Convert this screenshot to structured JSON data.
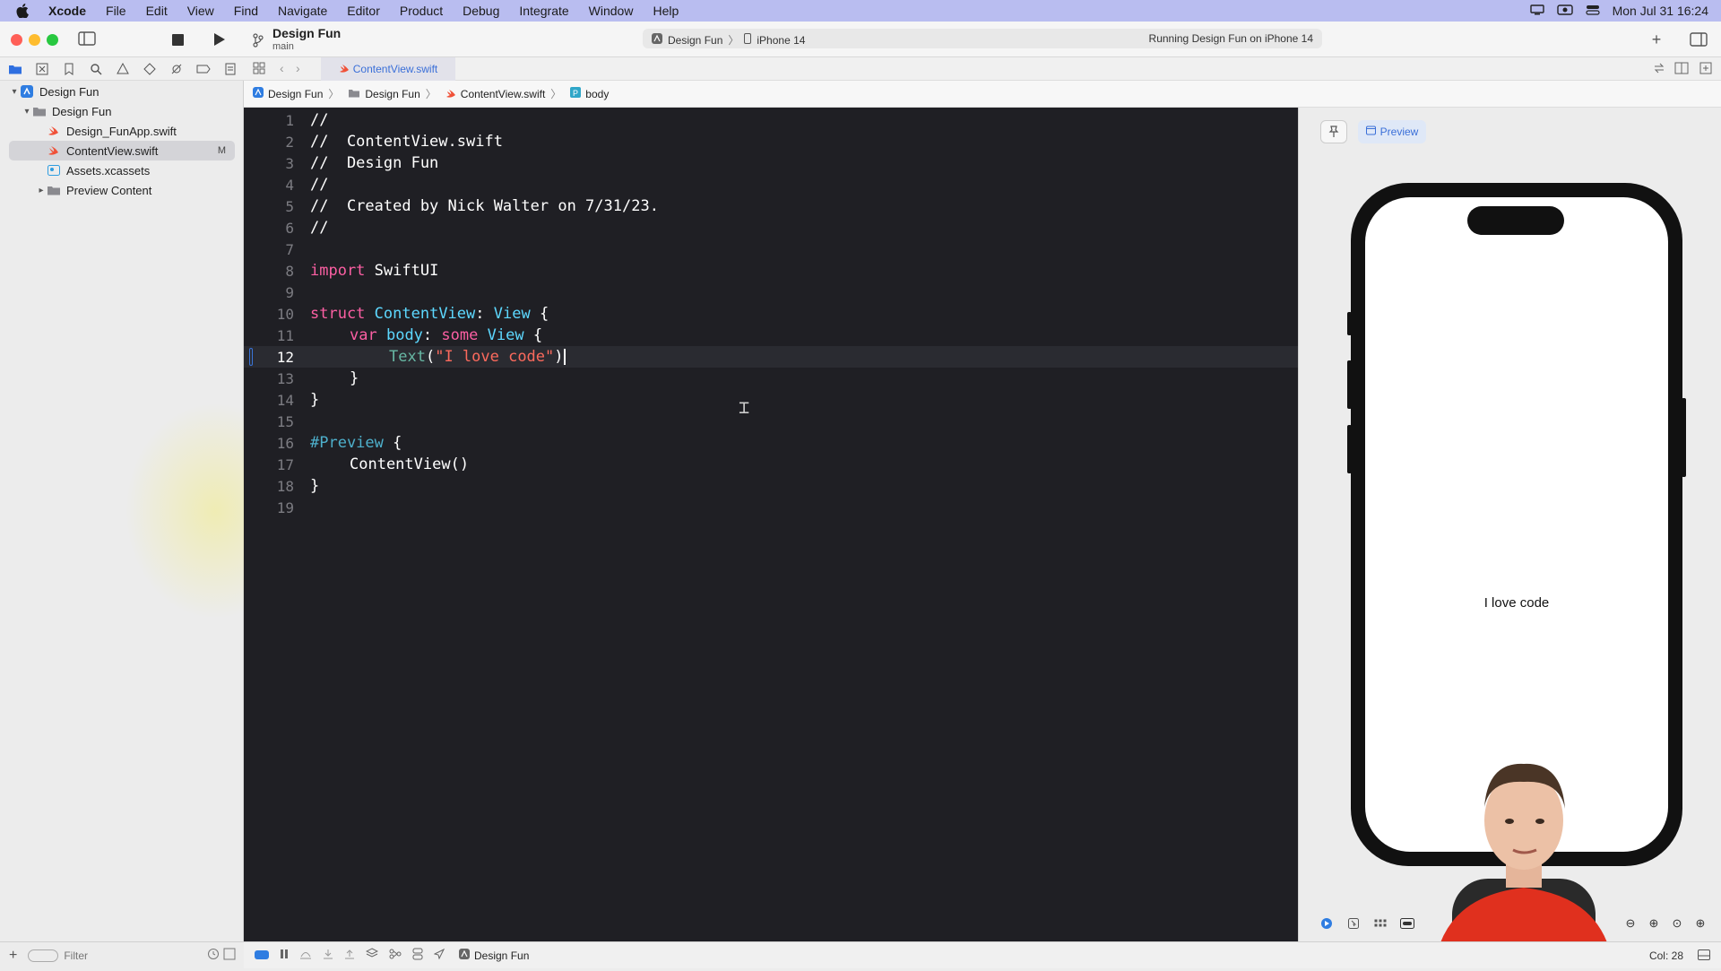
{
  "menubar": {
    "app": "Xcode",
    "items": [
      "File",
      "Edit",
      "View",
      "Find",
      "Navigate",
      "Editor",
      "Product",
      "Debug",
      "Integrate",
      "Window",
      "Help"
    ],
    "clock": "Mon Jul 31  16:24"
  },
  "toolbar": {
    "project_name": "Design Fun",
    "branch": "main",
    "scheme": "Design Fun",
    "destination": "iPhone 14",
    "status": "Running Design Fun on iPhone 14"
  },
  "navigator": {
    "items": [
      {
        "label": "Design Fun",
        "icon": "project-icon"
      },
      {
        "label": "Design Fun",
        "icon": "folder-icon"
      },
      {
        "label": "Design_FunApp.swift",
        "icon": "swift-file-icon"
      },
      {
        "label": "ContentView.swift",
        "icon": "swift-file-icon",
        "badge": "M"
      },
      {
        "label": "Assets.xcassets",
        "icon": "assets-icon"
      },
      {
        "label": "Preview Content",
        "icon": "folder-icon"
      }
    ],
    "filter_placeholder": "Filter"
  },
  "editor": {
    "tab": "ContentView.swift",
    "breadcrumb": [
      "Design Fun",
      "Design Fun",
      "ContentView.swift",
      "body"
    ],
    "current_line": 12,
    "line_numbers": [
      "1",
      "2",
      "3",
      "4",
      "5",
      "6",
      "7",
      "8",
      "9",
      "10",
      "11",
      "12",
      "13",
      "14",
      "15",
      "16",
      "17",
      "18",
      "19"
    ],
    "code": {
      "l1": "//",
      "l2": "//  ContentView.swift",
      "l3": "//  Design Fun",
      "l4": "//",
      "l5": "//  Created by Nick Walter on 7/31/23.",
      "l6": "//",
      "l8_kw": "import",
      "l8_mod": "SwiftUI",
      "l10_kw": "struct",
      "l10_name": "ContentView",
      "l10_colon": ":",
      "l10_type": "View",
      "l10_brace": "{",
      "l11_kw": "var",
      "l11_name": "body",
      "l11_colon": ":",
      "l11_some": "some",
      "l11_type": "View",
      "l11_brace": "{",
      "l12_fn": "Text",
      "l12_open": "(",
      "l12_str": "\"I love code\"",
      "l12_close": ")",
      "l13": "}",
      "l14": "}",
      "l16_macro": "#Preview",
      "l16_brace": "{",
      "l17_call": "ContentView()",
      "l18": "}"
    }
  },
  "preview": {
    "button_label": "Preview",
    "phone_text": "I love code"
  },
  "debugbar": {
    "target": "Design Fun",
    "col": "Col: 28"
  },
  "colors": {
    "menubar": "#b9bdf0",
    "editor_bg": "#1f1f24",
    "comment": "#6bbf59",
    "keyword": "#fc5fa3",
    "type": "#5dd8ff",
    "string": "#fc6a5d",
    "accent": "#3a6fd8"
  }
}
